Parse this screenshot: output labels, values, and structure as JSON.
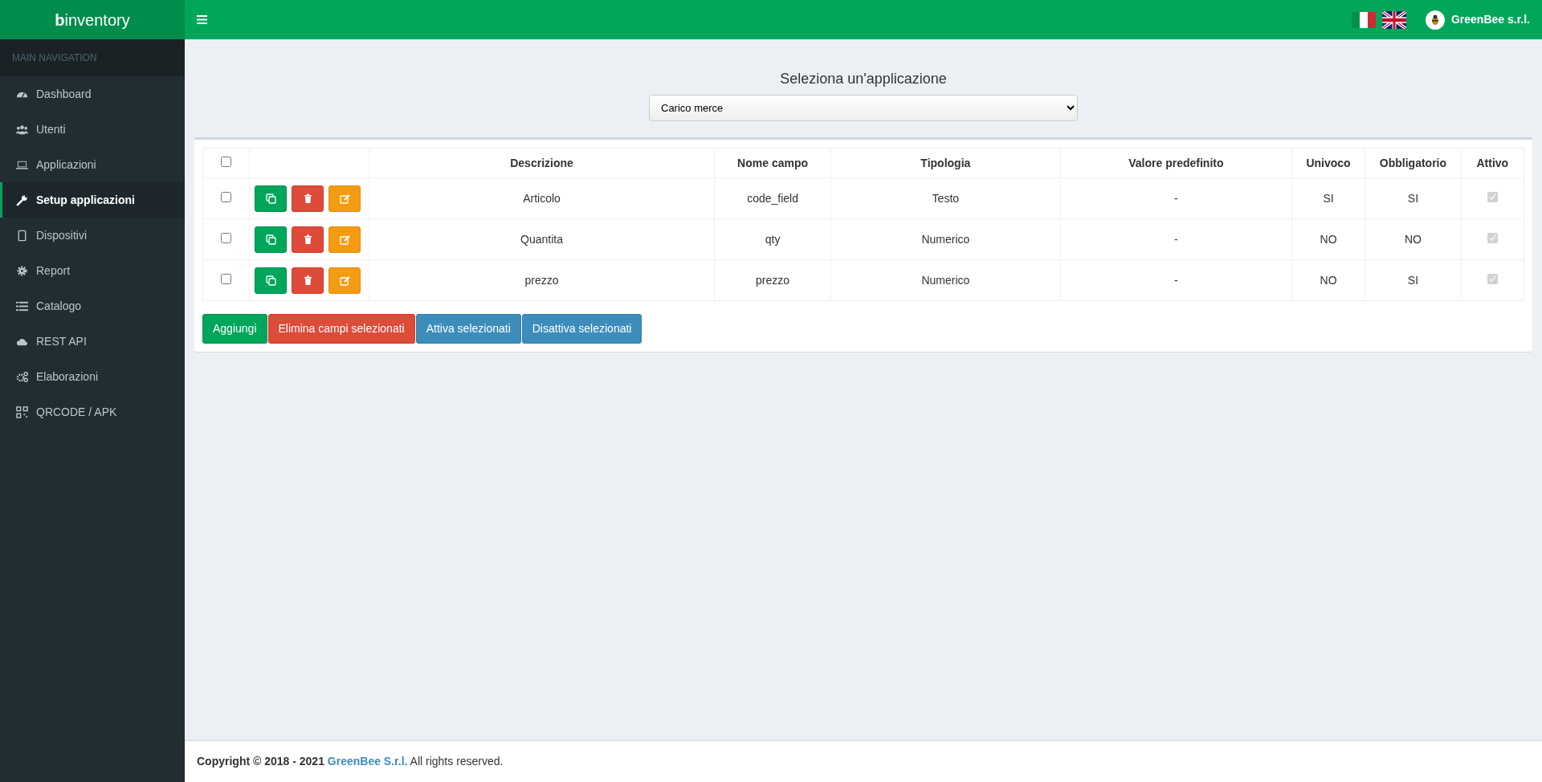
{
  "logo": "**b**inventory",
  "header": {
    "company": "GreenBee s.r.l."
  },
  "sidebar": {
    "heading": "MAIN NAVIGATION",
    "items": [
      {
        "label": "Dashboard",
        "selected": false
      },
      {
        "label": "Utenti",
        "selected": false
      },
      {
        "label": "Applicazioni",
        "selected": false
      },
      {
        "label": "Setup applicazioni",
        "selected": true
      },
      {
        "label": "Dispositivi",
        "selected": false
      },
      {
        "label": "Report",
        "selected": false
      },
      {
        "label": "Catalogo",
        "selected": false
      },
      {
        "label": "REST API",
        "selected": false
      },
      {
        "label": "Elaborazioni",
        "selected": false
      },
      {
        "label": "QRCODE / APK",
        "selected": false
      }
    ]
  },
  "app_select": {
    "label": "Seleziona un'applicazione",
    "value": "Carico merce"
  },
  "table": {
    "select_all": {
      "checked": false
    },
    "columns": [
      "Descrizione",
      "Nome campo",
      "Tipologia",
      "Valore predefinito",
      "Univoco",
      "Obbligatorio",
      "Attivo"
    ],
    "rows": [
      {
        "checked": false,
        "descrizione": "Articolo",
        "nome_campo": "code_field",
        "tipologia": "Testo",
        "valore": "-",
        "univoco": "SI",
        "obbligatorio": "SI",
        "attivo": true
      },
      {
        "checked": false,
        "descrizione": "Quantita",
        "nome_campo": "qty",
        "tipologia": "Numerico",
        "valore": "-",
        "univoco": "NO",
        "obbligatorio": "NO",
        "attivo": true
      },
      {
        "checked": false,
        "descrizione": "prezzo",
        "nome_campo": "prezzo",
        "tipologia": "Numerico",
        "valore": "-",
        "univoco": "NO",
        "obbligatorio": "SI",
        "attivo": true
      }
    ]
  },
  "buttons": [
    {
      "label": "Aggiungi",
      "kind": "success"
    },
    {
      "label": "Elimina campi selezionati",
      "kind": "danger"
    },
    {
      "label": "Attiva selezionati",
      "kind": "info"
    },
    {
      "label": "Disattiva selezionati",
      "kind": "info"
    }
  ],
  "footer": {
    "copyright": "Copyright © 2018 - 2021",
    "link": "GreenBee S.r.l.",
    "rest": "All rights reserved."
  }
}
